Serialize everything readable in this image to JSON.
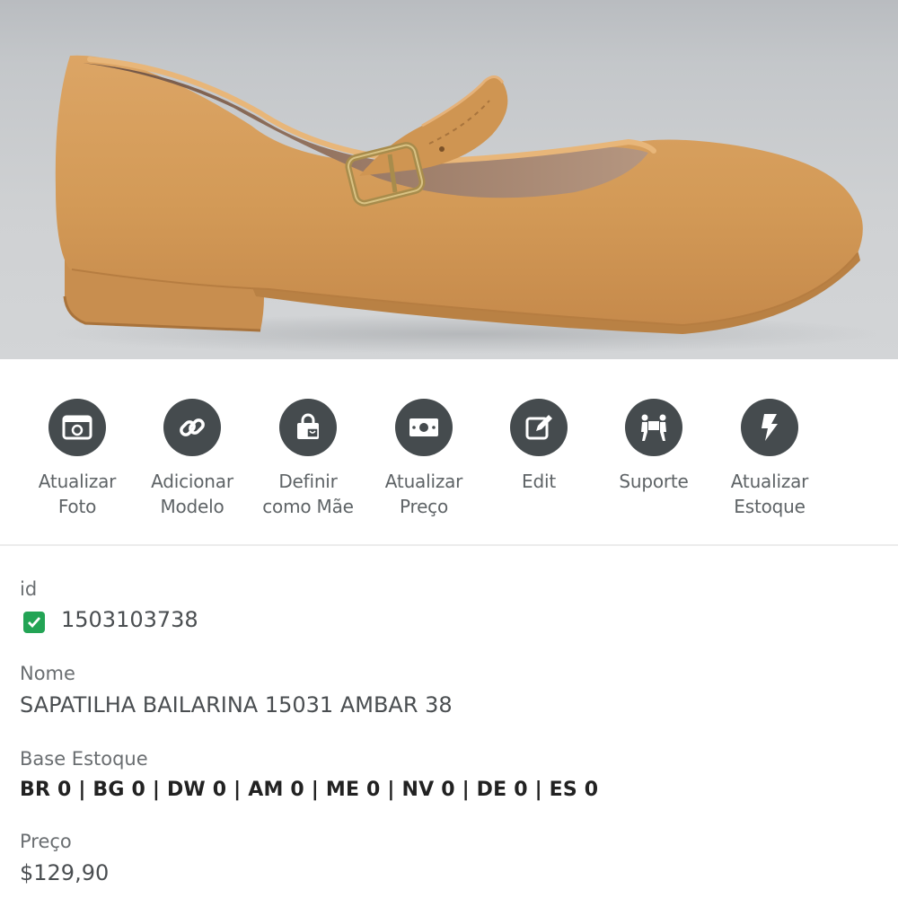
{
  "product_image": {
    "subject": "tan pointed-toe ballet flat with ankle strap and gold buckle",
    "colors": {
      "background": "#c9cbcd",
      "leather": "#d39a55",
      "lining": "#8b6a55",
      "sole": "#c98f4f",
      "buckle": "#b49a5a"
    }
  },
  "actions": [
    {
      "icon": "photo-icon",
      "label": "Atualizar\nFoto"
    },
    {
      "icon": "link-icon",
      "label": "Adicionar\nModelo"
    },
    {
      "icon": "shopping-bag-icon",
      "label": "Definir\ncomo Mãe"
    },
    {
      "icon": "money-icon",
      "label": "Atualizar\nPreço"
    },
    {
      "icon": "edit-icon",
      "label": "Edit"
    },
    {
      "icon": "support-icon",
      "label": "Suporte"
    },
    {
      "icon": "bolt-icon",
      "label": "Atualizar\nEstoque"
    }
  ],
  "details": {
    "id_label": "id",
    "id_value": "1503103738",
    "id_status_icon": "check-icon",
    "name_label": "Nome",
    "name_value": "SAPATILHA BAILARINA 15031 AMBAR 38",
    "stock_label": "Base Estoque",
    "stock_value": "BR 0 | BG 0 | DW 0 | AM 0 | ME 0 | NV 0 | DE 0 | ES 0",
    "price_label": "Preço",
    "price_value": "$129,90"
  },
  "colors": {
    "icon_circle": "#454b4e",
    "check_green": "#23a455",
    "label_text": "#5e6366"
  }
}
